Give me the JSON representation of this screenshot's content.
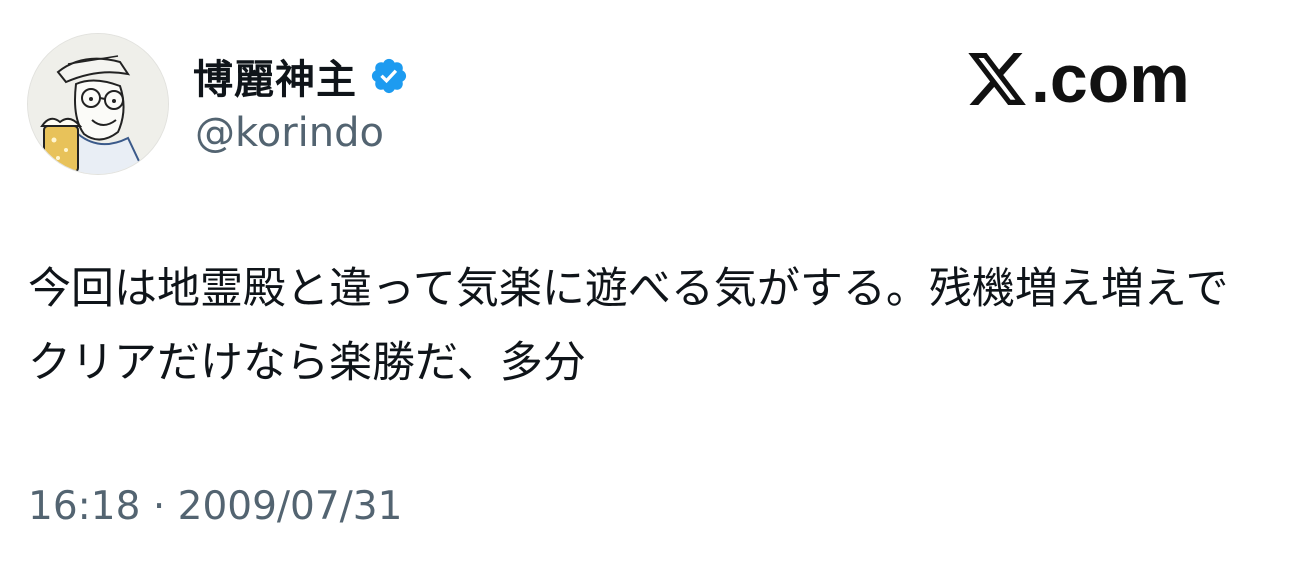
{
  "author": {
    "display_name": "博麗神主",
    "handle": "@korindo",
    "verified": true,
    "avatar_icon": "cartoon-man-with-beer-avatar"
  },
  "brand": {
    "text": ".com",
    "icon": "x-logo-icon"
  },
  "tweet": {
    "text": "今回は地霊殿と違って気楽に遊べる気がする。残機増え増えでクリアだけなら楽勝だ、多分",
    "time": "16:18",
    "separator": "·",
    "date": "2009/07/31"
  },
  "colors": {
    "verified_blue": "#1d9bf0",
    "secondary_text": "#536471",
    "primary_text": "#0f1419"
  }
}
